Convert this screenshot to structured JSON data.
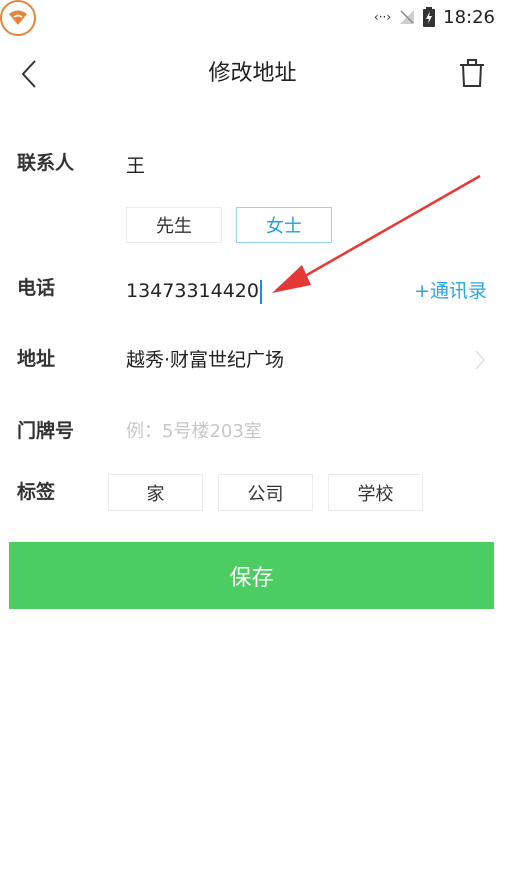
{
  "status_bar": {
    "time": "18:26",
    "nfc": "‹··›"
  },
  "header": {
    "title": "修改地址"
  },
  "form": {
    "contact": {
      "label": "联系人",
      "value": "王"
    },
    "gender": {
      "options": [
        "先生",
        "女士"
      ],
      "selected": "女士"
    },
    "phone": {
      "label": "电话",
      "value": "13473314420",
      "contacts_link": "+通讯录"
    },
    "address": {
      "label": "地址",
      "value": "越秀·财富世纪广场"
    },
    "house_number": {
      "label": "门牌号",
      "placeholder": "例：5号楼203室",
      "value": ""
    },
    "tags": {
      "label": "标签",
      "options": [
        "家",
        "公司",
        "学校"
      ]
    }
  },
  "save_button": {
    "label": "保存"
  },
  "colors": {
    "accent_blue": "#24a0dc",
    "save_green": "#4ccd62",
    "annotation_red": "#e53935",
    "app_badge_orange": "#e8843c"
  }
}
